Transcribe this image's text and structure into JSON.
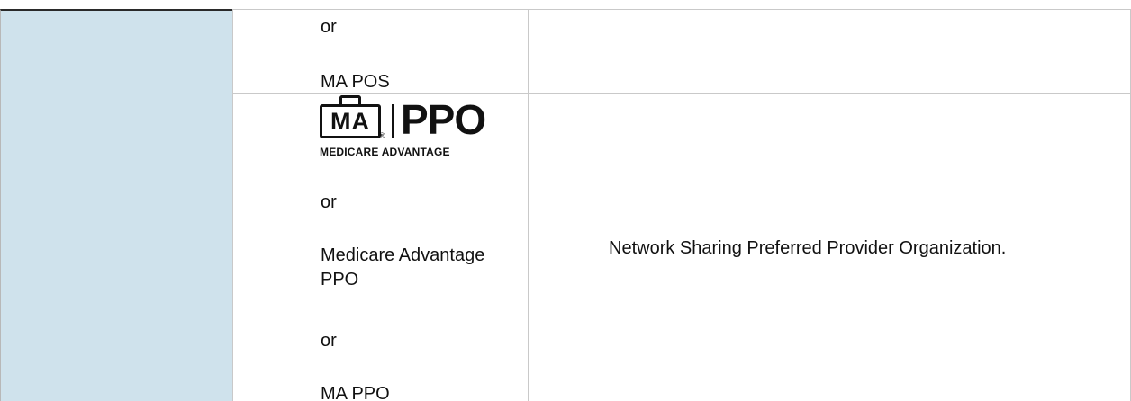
{
  "table": {
    "row1": {
      "col2_lines": [
        "or",
        "MA POS"
      ]
    },
    "row2": {
      "logo": {
        "badge_text": "MA",
        "registered_mark": "®",
        "plan_text": "PPO",
        "subtitle": "MEDICARE ADVANTAGE"
      },
      "col2_lines": [
        "or",
        "Medicare Advantage PPO",
        "or",
        "MA PPO"
      ],
      "description": "Network Sharing Preferred Provider Organization."
    }
  },
  "colors": {
    "side_column_bg": "#cfe2ec",
    "grid_line": "#c9c9c9",
    "text": "#111111"
  }
}
